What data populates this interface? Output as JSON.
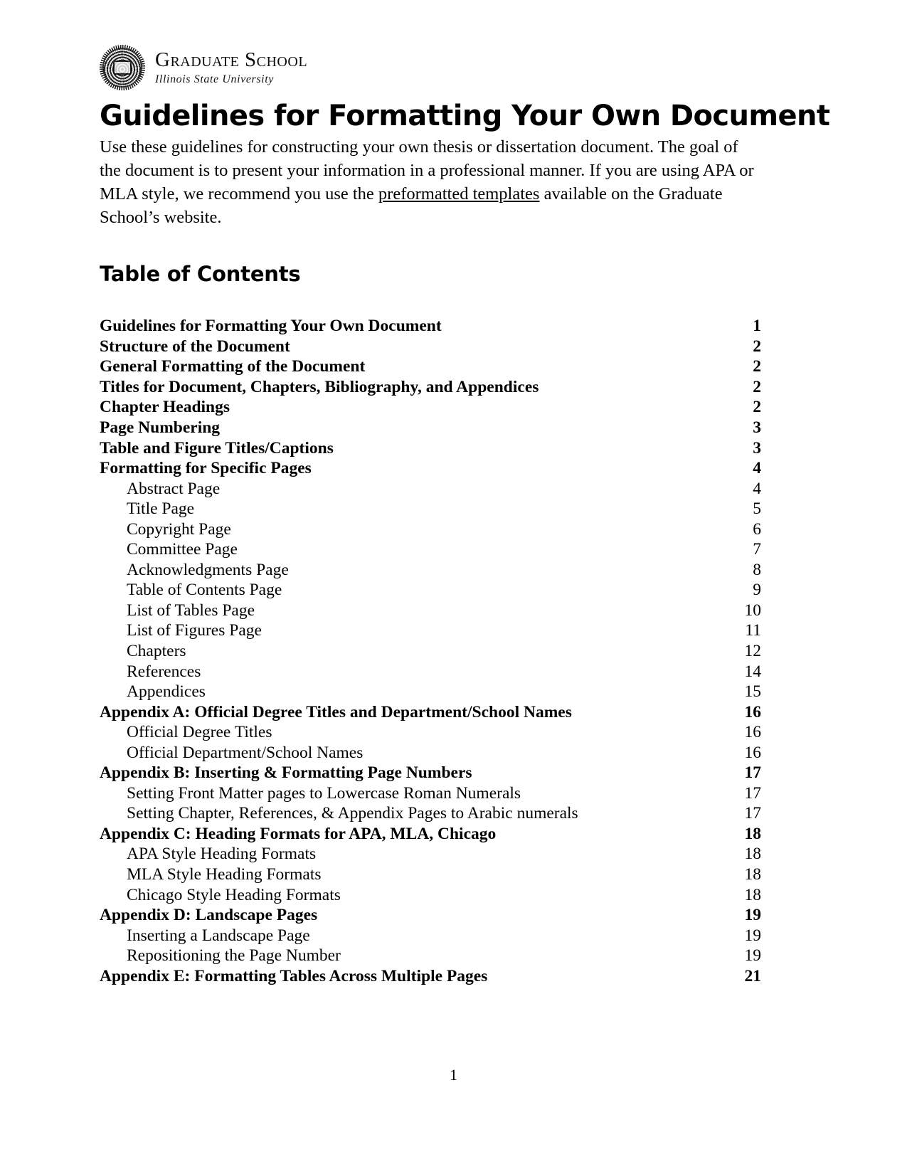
{
  "masthead": {
    "logo_icon": "isu-seal-icon",
    "wordmark_main": "Graduate School",
    "wordmark_sub": "Illinois State University"
  },
  "document": {
    "title": "Guidelines for Formatting Your Own Document",
    "intro_part1": "Use these guidelines for constructing your own thesis or dissertation document. The goal of the document is to present your information in a professional manner. If you are using APA or MLA style, we recommend you use the ",
    "intro_link": "preformatted templates",
    "intro_part2": " available on the Graduate School’s website.",
    "toc_heading": "Table of Contents",
    "footer_page_number": "1"
  },
  "toc": {
    "entries": [
      {
        "label": "Guidelines for Formatting Your Own Document",
        "page": "1",
        "level": 1
      },
      {
        "label": "Structure of the Document",
        "page": "2",
        "level": 1
      },
      {
        "label": "General Formatting of the Document",
        "page": "2",
        "level": 1
      },
      {
        "label": "Titles for Document, Chapters, Bibliography, and Appendices",
        "page": "2",
        "level": 1
      },
      {
        "label": "Chapter Headings",
        "page": "2",
        "level": 1
      },
      {
        "label": "Page Numbering",
        "page": "3",
        "level": 1
      },
      {
        "label": "Table and Figure Titles/Captions",
        "page": "3",
        "level": 1
      },
      {
        "label": "Formatting for Specific Pages",
        "page": "4",
        "level": 1
      },
      {
        "label": "Abstract Page",
        "page": "4",
        "level": 2
      },
      {
        "label": "Title Page",
        "page": "5",
        "level": 2
      },
      {
        "label": "Copyright Page",
        "page": "6",
        "level": 2
      },
      {
        "label": "Committee Page",
        "page": "7",
        "level": 2
      },
      {
        "label": "Acknowledgments Page",
        "page": "8",
        "level": 2
      },
      {
        "label": "Table of Contents Page",
        "page": "9",
        "level": 2
      },
      {
        "label": "List of Tables Page",
        "page": "10",
        "level": 2
      },
      {
        "label": "List of Figures Page",
        "page": "11",
        "level": 2
      },
      {
        "label": "Chapters",
        "page": "12",
        "level": 2
      },
      {
        "label": "References",
        "page": "14",
        "level": 2
      },
      {
        "label": "Appendices",
        "page": "15",
        "level": 2
      },
      {
        "label": "Appendix A: Official Degree Titles and Department/School Names",
        "page": "16",
        "level": 1
      },
      {
        "label": "Official Degree Titles",
        "page": "16",
        "level": 2
      },
      {
        "label": "Official Department/School Names",
        "page": "16",
        "level": 2
      },
      {
        "label": "Appendix B: Inserting & Formatting Page Numbers",
        "page": "17",
        "level": 1
      },
      {
        "label": "Setting Front Matter pages to Lowercase Roman Numerals",
        "page": "17",
        "level": 2
      },
      {
        "label": "Setting Chapter, References, & Appendix Pages to Arabic numerals",
        "page": "17",
        "level": 2
      },
      {
        "label": "Appendix C: Heading Formats for APA, MLA, Chicago",
        "page": "18",
        "level": 1
      },
      {
        "label": "APA Style Heading Formats",
        "page": "18",
        "level": 2
      },
      {
        "label": "MLA Style Heading Formats",
        "page": "18",
        "level": 2
      },
      {
        "label": "Chicago Style Heading Formats",
        "page": "18",
        "level": 2
      },
      {
        "label": "Appendix D: Landscape Pages",
        "page": "19",
        "level": 1
      },
      {
        "label": "Inserting a Landscape Page",
        "page": "19",
        "level": 2
      },
      {
        "label": "Repositioning the Page Number",
        "page": "19",
        "level": 2
      },
      {
        "label": "Appendix E: Formatting Tables Across Multiple Pages",
        "page": "21",
        "level": 1
      }
    ]
  }
}
